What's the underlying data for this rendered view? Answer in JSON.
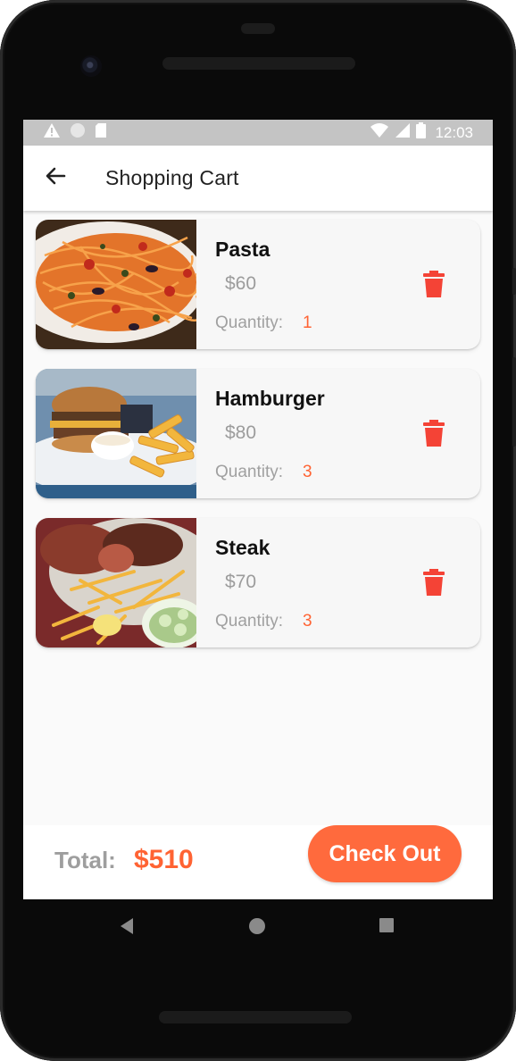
{
  "status_bar": {
    "time": "12:03",
    "left_icons": [
      "warning-icon",
      "circle-icon",
      "sd-card-icon"
    ],
    "right_icons": [
      "wifi-icon",
      "signal-icon",
      "battery-icon"
    ]
  },
  "app_bar": {
    "title": "Shopping Cart",
    "back_icon": "arrow-left-icon"
  },
  "cart": {
    "quantity_label": "Quantity:",
    "items": [
      {
        "name": "Pasta",
        "price": "$60",
        "quantity": "1",
        "image": "pasta-photo"
      },
      {
        "name": "Hamburger",
        "price": "$80",
        "quantity": "3",
        "image": "hamburger-photo"
      },
      {
        "name": "Steak",
        "price": "$70",
        "quantity": "3",
        "image": "steak-photo"
      }
    ]
  },
  "footer": {
    "total_label": "Total:",
    "total_value": "$510",
    "checkout_label": "Check Out"
  },
  "nav_bar": {
    "buttons": [
      "back-triangle-icon",
      "home-circle-icon",
      "recents-square-icon"
    ]
  },
  "colors": {
    "accent": "#ff6333",
    "checkout_button": "#ff6a3d",
    "delete_icon": "#f44336",
    "status_bar": "#c4c4c4"
  }
}
